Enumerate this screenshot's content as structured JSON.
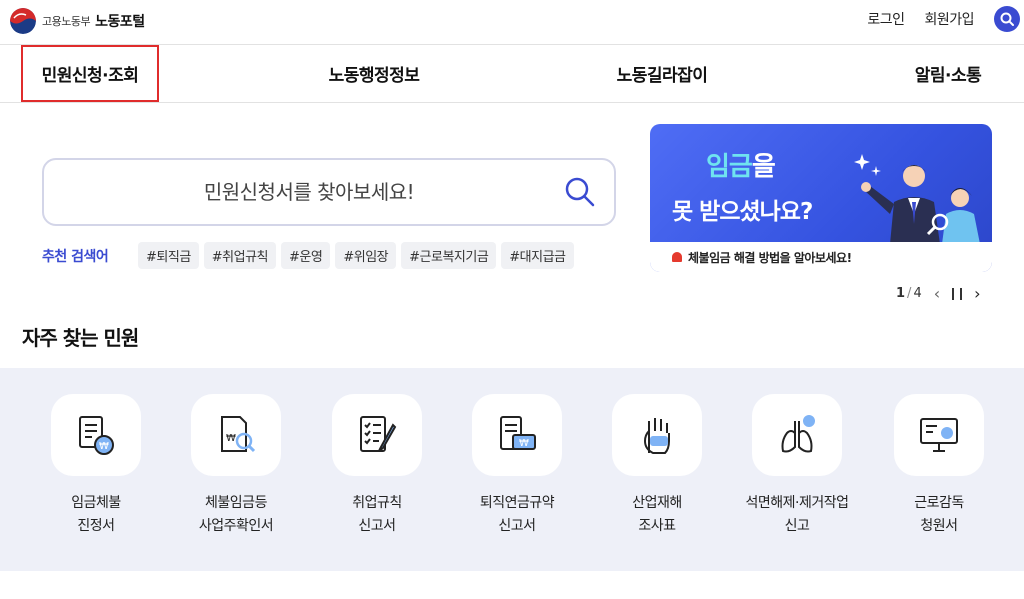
{
  "header": {
    "ministry": "고용노동부",
    "portal": "노동포털",
    "login": "로그인",
    "signup": "회원가입"
  },
  "nav": {
    "items": [
      {
        "label": "민원신청·조회",
        "active": true
      },
      {
        "label": "노동행정정보",
        "active": false
      },
      {
        "label": "노동길라잡이",
        "active": false
      },
      {
        "label": "알림·소통",
        "active": false
      }
    ]
  },
  "search": {
    "placeholder": "민원신청서를 찾아보세요!",
    "value": "",
    "recommended_label": "추천 검색어",
    "tags": [
      "#퇴직금",
      "#취업규칙",
      "#운영",
      "#위임장",
      "#근로복지기금",
      "#대지급금"
    ]
  },
  "banner": {
    "line1_highlight": "임금",
    "line1_rest": "을",
    "line2": "못 받으셨나요?",
    "footer": "체불임금 해결 방법을 알아보세요!",
    "page_current": "1",
    "page_total": "4"
  },
  "frequent": {
    "title": "자주 찾는 민원",
    "items": [
      {
        "line1": "임금체불",
        "line2": "진정서",
        "icon": "wage-document-icon"
      },
      {
        "line1": "체불임금등",
        "line2": "사업주확인서",
        "icon": "document-search-icon"
      },
      {
        "line1": "취업규칙",
        "line2": "신고서",
        "icon": "checklist-pen-icon"
      },
      {
        "line1": "퇴직연금규약",
        "line2": "신고서",
        "icon": "pension-document-icon"
      },
      {
        "line1": "산업재해",
        "line2": "조사표",
        "icon": "injured-hand-icon"
      },
      {
        "line1": "석면해제·제거작업",
        "line2": "신고",
        "icon": "lungs-icon"
      },
      {
        "line1": "근로감독",
        "line2": "청원서",
        "icon": "monitor-check-icon"
      }
    ]
  },
  "colors": {
    "accent": "#3a4bd1",
    "active_outline": "#e02c2c",
    "section_bg": "#eef0f8",
    "banner_bg": "#3d5ae6"
  }
}
